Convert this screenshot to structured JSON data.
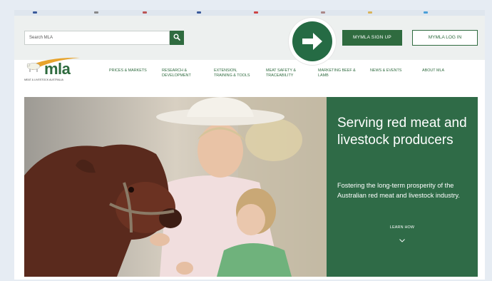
{
  "search": {
    "placeholder": "Search MLA"
  },
  "account": {
    "signup_label": "MYMLA SIGN UP",
    "login_label": "MYMLA LOG IN"
  },
  "logo": {
    "word": "mla",
    "tagline": "MEAT & LIVESTOCK AUSTRALIA"
  },
  "nav": {
    "items": [
      {
        "line1": "PRICES & MARKETS",
        "line2": ""
      },
      {
        "line1": "RESEARCH &",
        "line2": "DEVELOPMENT"
      },
      {
        "line1": "EXTENSION,",
        "line2": "TRAINING & TOOLS"
      },
      {
        "line1": "MEAT SAFETY &",
        "line2": "TRACEABILITY"
      },
      {
        "line1": "MARKETING BEEF &",
        "line2": "LAMB"
      },
      {
        "line1": "NEWS & EVENTS",
        "line2": ""
      },
      {
        "line1": "ABOUT MLA",
        "line2": ""
      }
    ]
  },
  "hero": {
    "title": "Serving red meat and livestock producers",
    "subtitle": "Fostering the long-term prosperity of the Australian red meat and livestock industry.",
    "cta": "LEARN HOW"
  },
  "colors": {
    "brand_green": "#2f6b3f",
    "panel_green": "#2f6b47",
    "callout_green": "#256b44"
  },
  "icons": {
    "search": "search-icon",
    "callout": "arrow-right-icon",
    "cta": "chevron-down-icon"
  }
}
